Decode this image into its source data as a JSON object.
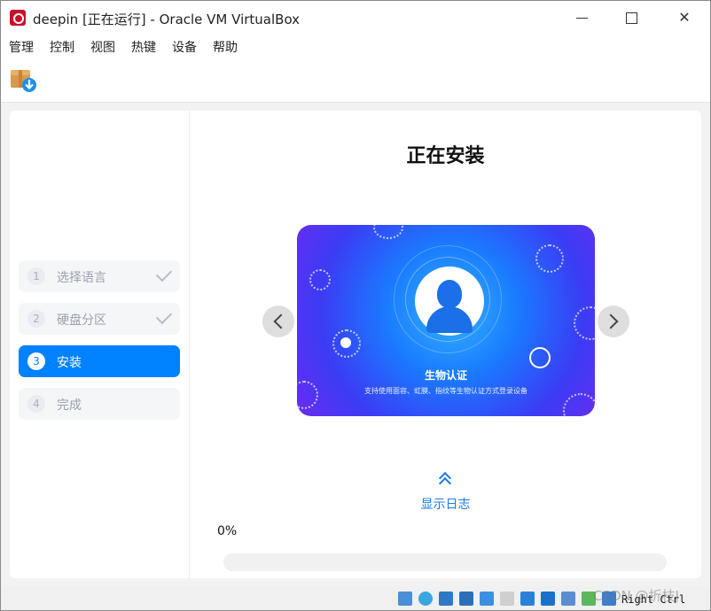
{
  "window": {
    "title": "deepin [正在运行] - Oracle VM VirtualBox",
    "close_glyph": "✕"
  },
  "menubar": {
    "items": [
      {
        "label": "管理"
      },
      {
        "label": "控制"
      },
      {
        "label": "视图"
      },
      {
        "label": "热键"
      },
      {
        "label": "设备"
      },
      {
        "label": "帮助"
      }
    ]
  },
  "toolbar": {
    "icon": "package-download-icon"
  },
  "installer": {
    "steps": [
      {
        "num": "1",
        "label": "选择语言",
        "status": "done"
      },
      {
        "num": "2",
        "label": "硬盘分区",
        "status": "done"
      },
      {
        "num": "3",
        "label": "安装",
        "status": "active"
      },
      {
        "num": "4",
        "label": "完成",
        "status": "pending"
      }
    ],
    "heading": "正在安装",
    "slide": {
      "title": "生物认证",
      "subtitle": "支持使用面容、虹膜、指纹等生物认证方式登录设备"
    },
    "log_link": "显示日志",
    "progress_text": "0%",
    "progress_value": 0,
    "accent_color": "#0081ff"
  },
  "statusbar": {
    "icons": [
      "hard-disk-icon",
      "optical-drive-icon",
      "audio-icon",
      "network-icon",
      "usb-icon",
      "shared-folder-icon",
      "display-icon",
      "screen-capture-icon",
      "video-capture-icon",
      "cpu-icon",
      "mouse-integration-icon",
      "keyboard-icon"
    ],
    "host_key": "Right Ctrl",
    "watermark": "CSDN @折枝J"
  }
}
